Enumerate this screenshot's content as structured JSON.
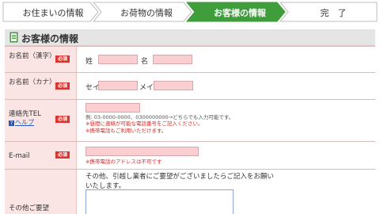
{
  "steps": [
    {
      "label": "お住まいの情報",
      "active": false
    },
    {
      "label": "お荷物の情報",
      "active": false
    },
    {
      "label": "お客様の情報",
      "active": true
    },
    {
      "label": "完　了",
      "active": false
    }
  ],
  "colors": {
    "active_step": "#3f9d3c",
    "required_badge": "#d8352f",
    "label_bg": "#fbe4e4",
    "input_bg": "#fbcfd1",
    "link": "#2a5cb7"
  },
  "section": {
    "title": "お客様の情報",
    "icon": "form-document-icon"
  },
  "required_label": "必須",
  "rows": {
    "name_kanji": {
      "label": "お名前（漢字）",
      "last_prefix": "姓",
      "first_prefix": "名"
    },
    "name_kana": {
      "label": "お名前（カナ）",
      "last_prefix": "セイ",
      "first_prefix": "メイ"
    },
    "tel": {
      "label": "連絡先TEL",
      "help": "ヘルプ",
      "example": "例: 03-0000-0000、0300000000→どちらでも入力可能です。",
      "note1": "※昼間に連絡が可能な電話番号をご記入ください。",
      "note2": "※携帯電話もご利用いただけます。"
    },
    "email": {
      "label": "E-mail",
      "note": "※携帯電話のアドレスは不可です"
    },
    "request": {
      "label": "その他ご要望",
      "desc": "その他、引越し業者にご要望がございましたらご記入をお願いいたします。"
    }
  }
}
